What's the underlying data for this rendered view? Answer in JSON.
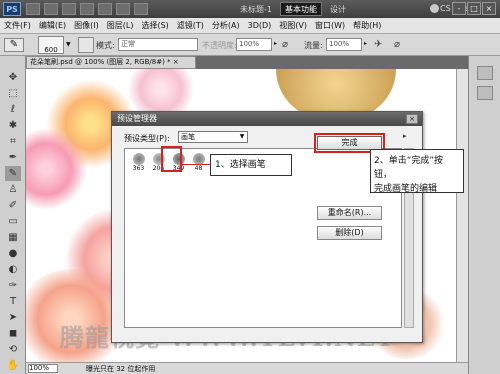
{
  "app": {
    "logo": "PS",
    "doc_title": "未标题-1",
    "workspace_button": "基本功能",
    "design_button": "设计",
    "cs_live": "CS Live",
    "window_buttons": [
      "-",
      "□",
      "×"
    ]
  },
  "menubar": {
    "items": [
      "文件(F)",
      "编辑(E)",
      "图像(I)",
      "图层(L)",
      "选择(S)",
      "滤镜(T)",
      "分析(A)",
      "3D(D)",
      "视图(V)",
      "窗口(W)",
      "帮助(H)"
    ]
  },
  "options": {
    "brush_size": "600",
    "mode_label": "模式:",
    "mode_value": "正常",
    "opacity_label": "不透明度:",
    "opacity_value": "100%",
    "flow_label": "流量:",
    "flow_value": "100%"
  },
  "document": {
    "tab_label": "花朵笔刷.psd @ 100% (图层 2, RGB/8#) * ×",
    "zoom": "100%",
    "status": "曝光只在 32 位起作用",
    "watermark": "腾龍視覺 WWW.TLVI.NET"
  },
  "dialog": {
    "title": "预设管理器",
    "close": "×",
    "type_label": "预设类型(P):",
    "type_value": "画笔",
    "menu_arrow": "▸",
    "brushes": [
      {
        "num": "363",
        "color": "#8a8a8a"
      },
      {
        "num": "206",
        "color": "#9a9a9a"
      },
      {
        "num": "349",
        "color": "#7a7a7a"
      },
      {
        "num": "48",
        "color": "#8c8c8c"
      }
    ],
    "done_button": "完成",
    "rename_button": "重命名(R)...",
    "delete_button": "删除(D)"
  },
  "callouts": {
    "step1": "1、选择画笔",
    "step2_line1": "2、单击“完成”按钮，",
    "step2_line2": "完成画笔的编辑"
  },
  "colors": {
    "highlight": "#d42020",
    "dialog_title": "#555555"
  }
}
